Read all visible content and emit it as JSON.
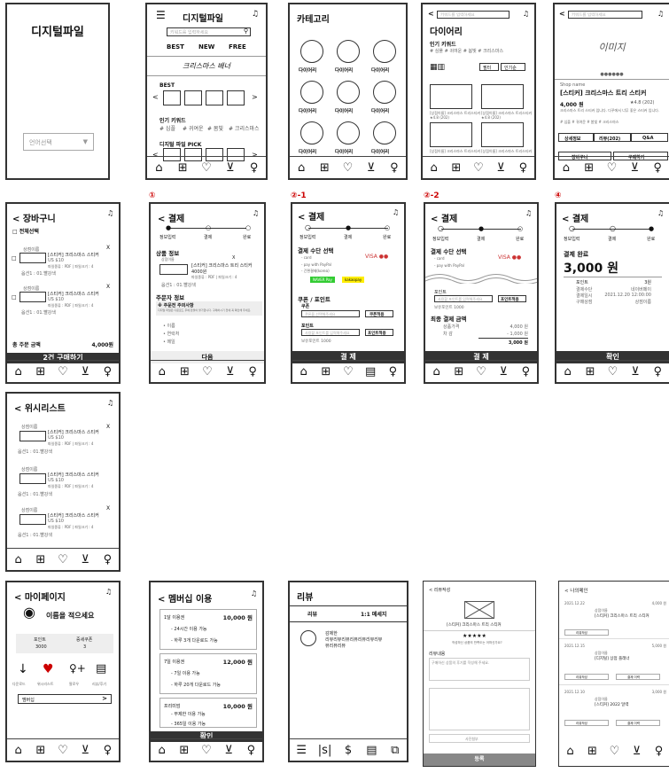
{
  "nav_icons": [
    "⌂",
    "⊞",
    "♡",
    "🛒",
    "👤"
  ],
  "labels": {
    "s1": "①",
    "s21": "②-1",
    "s22": "②-2",
    "s4": "④"
  },
  "p1": {
    "title": "디지털파일",
    "lang": "언어선택",
    "chev": "▼"
  },
  "p2": {
    "title": "디지털파일",
    "search": "키워드를 입력하세요",
    "tabs": [
      "BEST",
      "NEW",
      "FREE"
    ],
    "banner": "크리스마스 배너",
    "best": "BEST",
    "kw_title": "인기 키워드",
    "kw": [
      "# 심플",
      "# 귀여운",
      "# 봄빛",
      "# 크리스마스"
    ],
    "pick": "디지털 파일 PICK"
  },
  "p3": {
    "title": "카테고리",
    "cat": "다이어리"
  },
  "p4": {
    "search": "키워드를 입력하세요",
    "title": "다이어리",
    "kw_title": "인기 키워드",
    "kw": "# 심플   # 귀여운   # 봄빛   # 크리스마스",
    "filter": "필터",
    "sort": "인기순",
    "item": "[상점이름] 크리스마스 트리스티커",
    "rating": "★4.8 (202)",
    "price": "US $10"
  },
  "p5": {
    "search": "키워드를 입력하세요",
    "img": "이미지",
    "shop": "Shop name",
    "title": "[스티커] 크리스마스 트리 스티커",
    "price": "4,000 원",
    "rating": "★4.8 (202)",
    "desc": "크리스마스 트리 스티커 입니다. 다꾸에서 너무 좋은 스티커 입니다.",
    "kw": "# 심플   # 귀여운   # 봄빛   # 크리스마스",
    "tabs": [
      "상세정보",
      "리뷰(202)",
      "Q&A"
    ],
    "cart": "장바구니",
    "buy": "구매하기"
  },
  "p6": {
    "title": "< 장바구니",
    "sel": "전체선택",
    "shop": "상점이름",
    "name": "[스티커] 크리스마스 스티커",
    "price": "US $10",
    "opt": "파일종류 : PDF | 파일크기 : 4",
    "qty": "옵션1 : 01.빨강색",
    "total": "총 주문 금액",
    "total_v": "4,000원",
    "btn": "2건 구매하기"
  },
  "p7": {
    "title": "< 결제",
    "steps": [
      "정보입력",
      "결제",
      "완료"
    ],
    "sec1": "상품 정보",
    "shop": "상점이름",
    "name": "[스티커] 크리스마스 트리 스티커",
    "price": "4000원",
    "opt": "파일종류 : PDF | 파일크기 : 4",
    "qty": "옵션1 : 01.빨강색",
    "sec2": "주문자 정보",
    "note": "※ 주문전 주의사항",
    "note2": "디지털 파일은 다운로드 후에 환불이 불가합니다. 구매하시기 전에 꼭 확인해 주세요.",
    "fields": [
      "• 이름",
      "• 연락처",
      "• 메일"
    ],
    "btn": "다음"
  },
  "p8": {
    "title": "< 결제",
    "steps": [
      "정보입력",
      "결제",
      "완료"
    ],
    "sec1": "결제 수단 선택",
    "opts": [
      "- card",
      "- pay with PayPal",
      "- 간편결제(korea)"
    ],
    "pay": [
      "NAVER Pay",
      "kakaopay"
    ],
    "sec2": "쿠폰 / 포인트",
    "coupon": "쿠폰",
    "cph": "쿠폰을 선택해주세요",
    "cbtn": "쿠폰적용",
    "point": "포인트",
    "pph": "사용할 포인트를 입력해주세요",
    "pbtn": "포인트적용",
    "have": "보유포인트 1000",
    "btn": "결 제"
  },
  "p9": {
    "title": "< 결제",
    "steps": [
      "정보입력",
      "결제",
      "완료"
    ],
    "sec1": "결제 수단 선택",
    "opts": [
      "- card",
      "- pay with PayPal"
    ],
    "point": "포인트",
    "pph": "사용할 포인트를 입력해주세요",
    "pbtn": "포인트적용",
    "have": "보유포인트 1000",
    "sec2": "최종 결제 금액",
    "rows": [
      [
        "상품가격",
        "4,000 원"
      ],
      [
        "차    감",
        "- 1,000 원"
      ],
      [
        "",
        "3,000 원"
      ]
    ],
    "btn": "결 제"
  },
  "p10": {
    "title": "< 결제",
    "steps": [
      "정보입력",
      "결제",
      "완료"
    ],
    "done": "결제 완료",
    "amt": "3,000 원",
    "rows": [
      [
        "포인트",
        "3원"
      ],
      [
        "결제수단",
        "네이버페이"
      ],
      [
        "결제일시",
        "2021.12.20 12:00:00"
      ],
      [
        "구매상점",
        "상점이름"
      ]
    ],
    "btn": "확인"
  },
  "p11": {
    "title": "< 위시리스트",
    "shop": "상점이름",
    "name": "[스티커] 크리스마스 스티커",
    "price": "US $10",
    "opt": "파일종류 : PDF | 파일크기 : 4",
    "qty": "옵션1 : 01.빨강색"
  },
  "p12": {
    "title": "< 마이페이지",
    "name": "이름을 적으세요",
    "c1": "포인트",
    "c1v": "3000",
    "c2": "증세쿠폰",
    "c2v": "3",
    "icons": [
      [
        "↓",
        "다운로드"
      ],
      [
        "♥",
        "위시리스트"
      ],
      [
        "♀+",
        "팔로우"
      ],
      [
        "▤",
        "리뷰/후기"
      ]
    ],
    "member": "멤버십",
    "arrow": ">"
  },
  "p13": {
    "title": "< 멤버십 이용",
    "plans": [
      {
        "name": "1달 이용권",
        "price": "10,000 원",
        "l1": "- 24시간 이용 가능",
        "l2": "- 하루 3개 다운로드 가능"
      },
      {
        "name": "7일 이용권",
        "price": "12,000 원",
        "l1": "- 7일 이용 가능",
        "l2": "- 하루 20개 다운로드 가능"
      },
      {
        "name": "프리미엄",
        "price": "10,000 원",
        "l1": "- 무제한 이용 가능",
        "l2": "- 365일 이용 가능"
      }
    ],
    "btn": "확인"
  },
  "p14": {
    "title": "리뷰",
    "tabs": [
      "리뷰",
      "1:1 메세지"
    ],
    "user": "감제한",
    "text": "리뷰리뷰리뷰리뷰리뷰리뷰리뷰",
    "text2": "뷰리뷰리뷰",
    "nav": [
      "☰",
      "|s|",
      "$",
      "▤",
      "⧉"
    ]
  },
  "p15": {
    "title": "< 리뷰작성",
    "prod": "[스티커] 크리스마스 트리 스티커",
    "stars": "★★★★★",
    "q": "작성하신 상품의 만족도는 어떠신가요?",
    "sec": "리뷰내용",
    "ph": "구매하신 상품의 후기를 작성해 주세요.",
    "photo": "사진첨부",
    "btn": "등록"
  },
  "p16": {
    "title": "< 나의메인",
    "entries": [
      {
        "date": "2021.12.22",
        "shop": "상점이름",
        "name": "[스티커] 크리스마스 트리 스티커",
        "price": "4,000 원",
        "btn1": "리뷰작성",
        "btn2": ""
      },
      {
        "date": "2021.12.15",
        "shop": "상점이름",
        "name": "[디지털] 상점 플래너",
        "price": "5,000 원",
        "btn1": "리뷰작성",
        "btn2": "결제 이력"
      },
      {
        "date": "2021.12.10",
        "shop": "상점이름",
        "name": "[스티커] 2022 달력",
        "price": "3,000 원",
        "btn1": "리뷰작성",
        "btn2": "결제 이력"
      }
    ]
  }
}
